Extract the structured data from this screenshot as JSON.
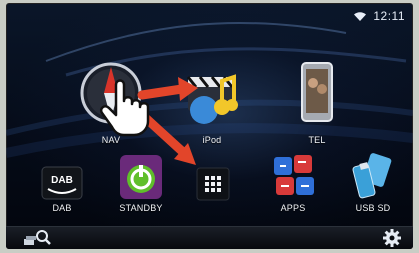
{
  "status": {
    "time": "12:11"
  },
  "apps": [
    {
      "id": "nav",
      "label": "NAV",
      "icon": "compass-icon"
    },
    {
      "id": "ipod",
      "label": "iPod",
      "icon": "music-note-icon"
    },
    {
      "id": "tel",
      "label": "TEL",
      "icon": "phone-icon"
    },
    {
      "id": "dab",
      "label": "DAB",
      "icon": "dab-icon"
    },
    {
      "id": "standby",
      "label": "STANDBY",
      "icon": "power-icon"
    },
    {
      "id": "apps",
      "label": "APPS",
      "icon": "apps-icon"
    },
    {
      "id": "usbsd",
      "label": "USB SD",
      "icon": "usb-sd-icon"
    }
  ],
  "colors": {
    "accent_arrow": "#e2452a",
    "power_green": "#5fbf2a"
  }
}
